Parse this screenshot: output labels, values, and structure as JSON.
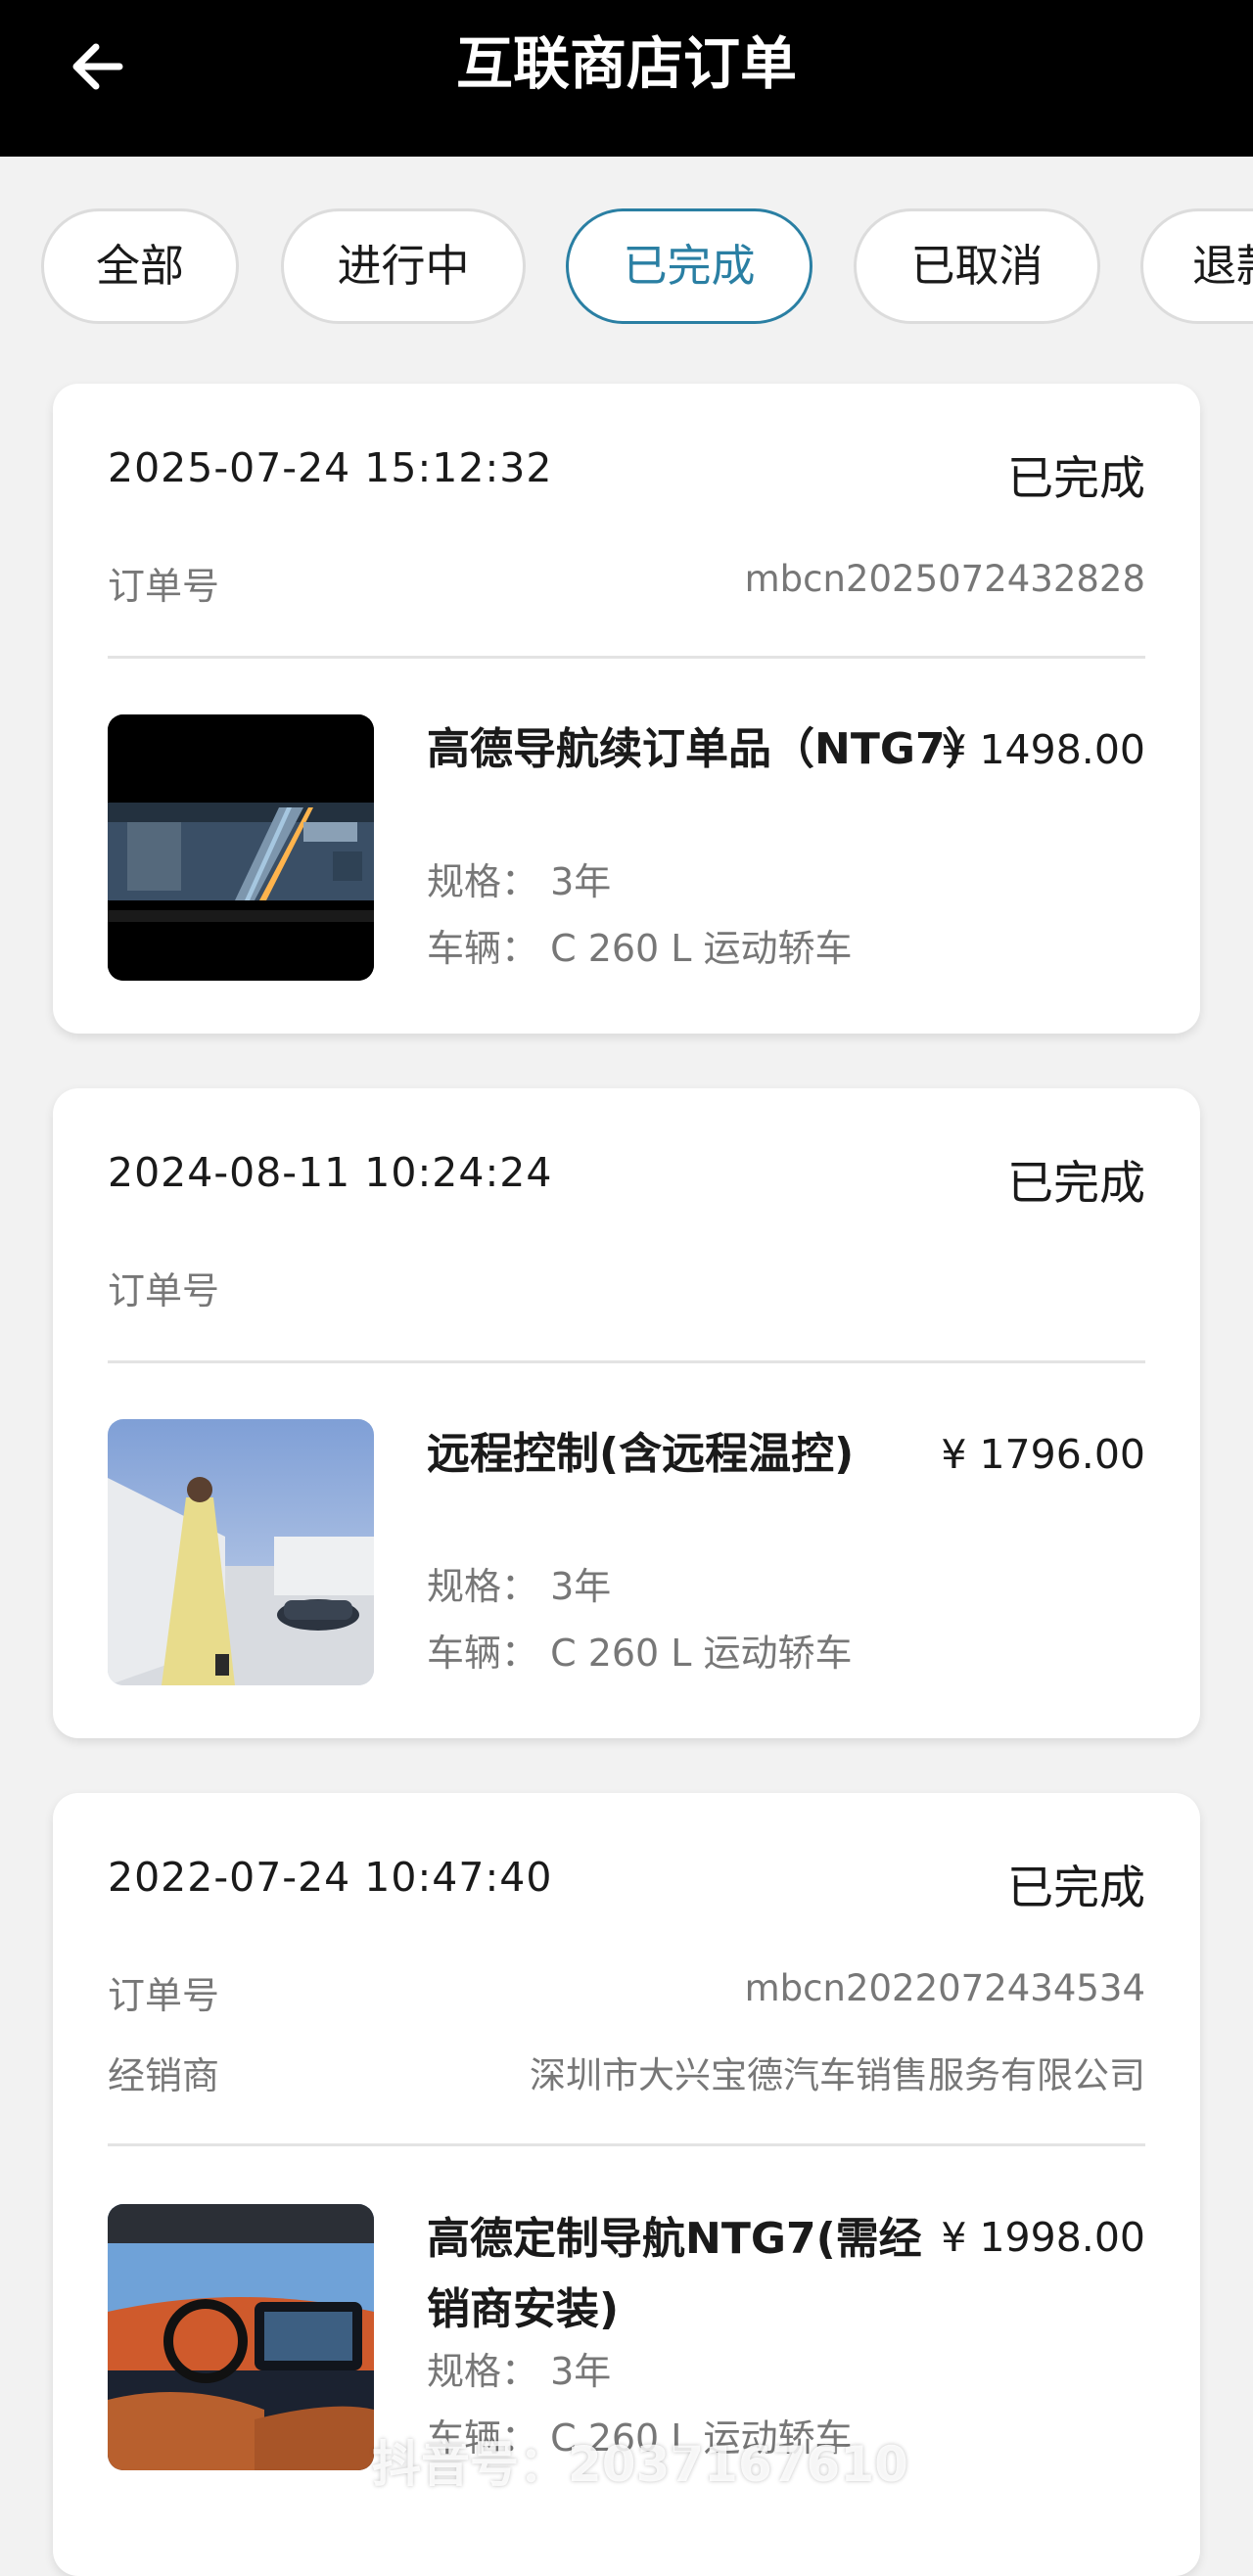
{
  "header": {
    "title": "互联商店订单"
  },
  "tabs": [
    {
      "label": "全部"
    },
    {
      "label": "进行中"
    },
    {
      "label": "已完成"
    },
    {
      "label": "已取消"
    },
    {
      "label": "退款"
    }
  ],
  "orders": [
    {
      "datetime": "2025-07-24 15:12:32",
      "status": "已完成",
      "order_no_label": "订单号",
      "order_no": "mbcn2025072432828",
      "product": {
        "name": "高德导航续订单品（NTG7）",
        "price": "¥ 1498.00",
        "spec": "规格：  3年",
        "vehicle": "车辆：  C 260 L 运动轿车"
      }
    },
    {
      "datetime": "2024-08-11 10:24:24",
      "status": "已完成",
      "order_no_label": "订单号",
      "order_no": "",
      "product": {
        "name": "远程控制(含远程温控)",
        "price": "¥ 1796.00",
        "spec": "规格：  3年",
        "vehicle": "车辆：  C 260 L 运动轿车"
      }
    },
    {
      "datetime": "2022-07-24 10:47:40",
      "status": "已完成",
      "order_no_label": "订单号",
      "order_no": "mbcn2022072434534",
      "dealer_label": "经销商",
      "dealer": "深圳市大兴宝德汽车销售服务有限公司",
      "product": {
        "name": "高德定制导航NTG7(需经销商安装)",
        "price": "¥ 1998.00",
        "spec": "规格：  3年",
        "vehicle": "车辆：  C 260 L 运动轿车"
      }
    }
  ],
  "watermark": "抖音号：2037167610"
}
